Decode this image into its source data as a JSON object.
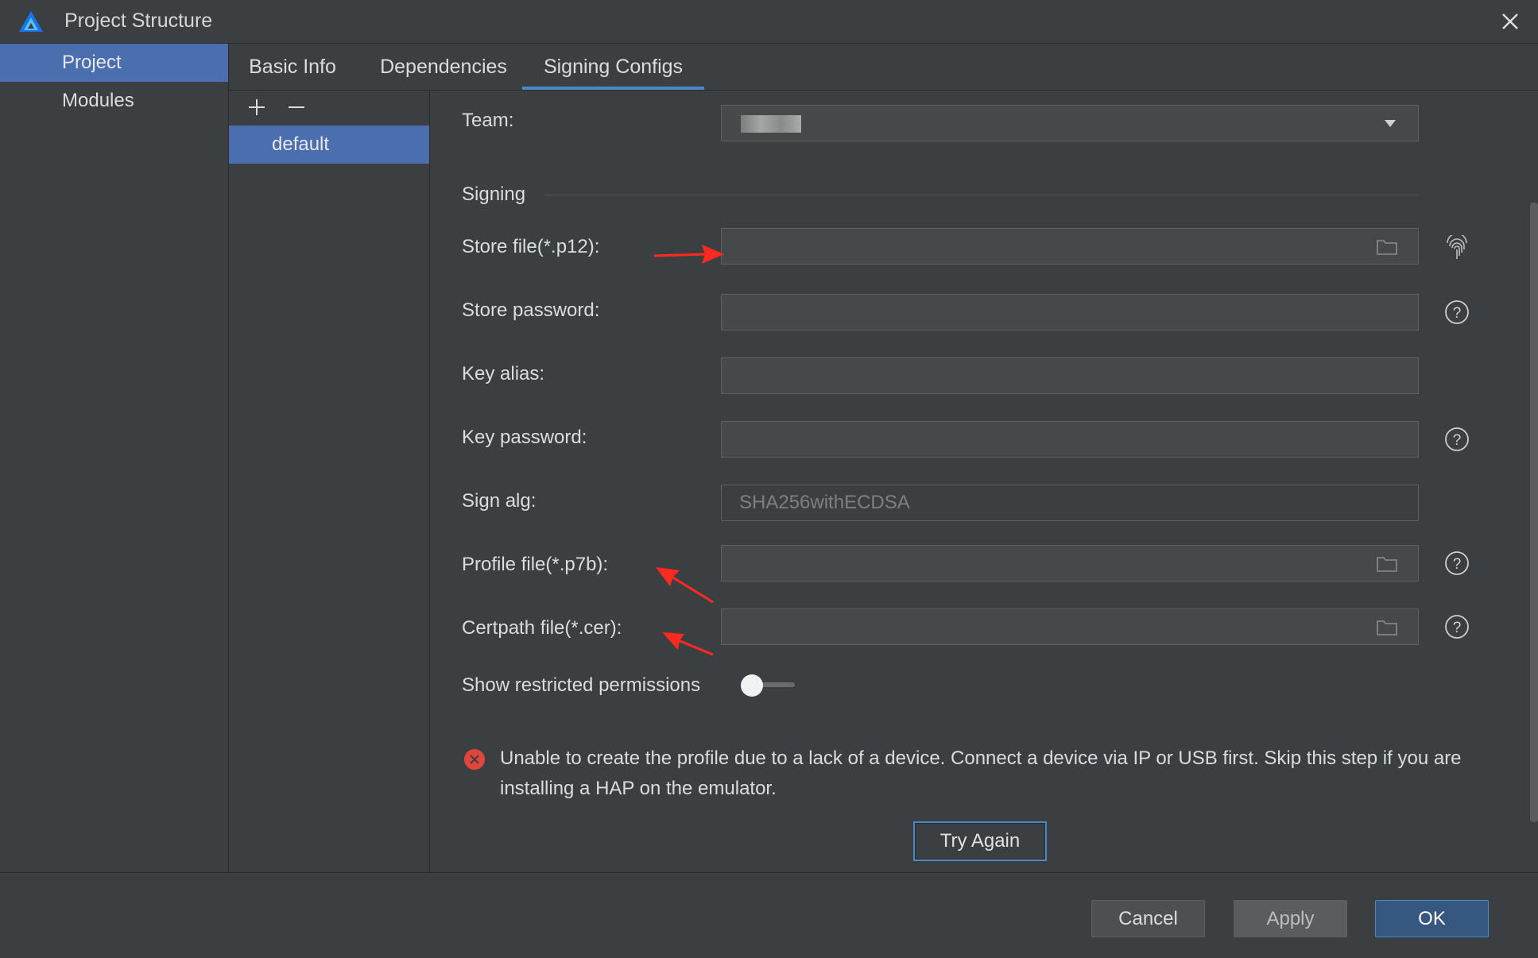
{
  "window": {
    "title": "Project Structure"
  },
  "nav": {
    "items": [
      {
        "label": "Project",
        "active": true
      },
      {
        "label": "Modules",
        "active": false
      }
    ]
  },
  "tabs": [
    {
      "label": "Basic Info"
    },
    {
      "label": "Dependencies"
    },
    {
      "label": "Signing Configs",
      "active": true
    }
  ],
  "config_list": {
    "items": [
      {
        "label": "default",
        "selected": true
      }
    ]
  },
  "form": {
    "team_label": "Team:",
    "team_value": "",
    "signing_section": "Signing",
    "store_file_label": "Store file(*.p12):",
    "store_password_label": "Store password:",
    "key_alias_label": "Key alias:",
    "key_password_label": "Key password:",
    "sign_alg_label": "Sign alg:",
    "sign_alg_value": "SHA256withECDSA",
    "profile_file_label": "Profile file(*.p7b):",
    "certpath_file_label": "Certpath file(*.cer):",
    "show_restricted_label": "Show restricted permissions",
    "show_restricted_on": false,
    "error_text": "Unable to create the profile due to a lack of a device. Connect a device via IP or USB first. Skip this step if you are installing a HAP on the emulator.",
    "try_again_label": "Try Again"
  },
  "buttons": {
    "cancel": "Cancel",
    "apply": "Apply",
    "ok": "OK"
  },
  "colors": {
    "accent": "#4b6eaf",
    "tab_underline": "#4a88c7",
    "error": "#e0463b",
    "annotation_arrow": "#ff2a1f"
  }
}
